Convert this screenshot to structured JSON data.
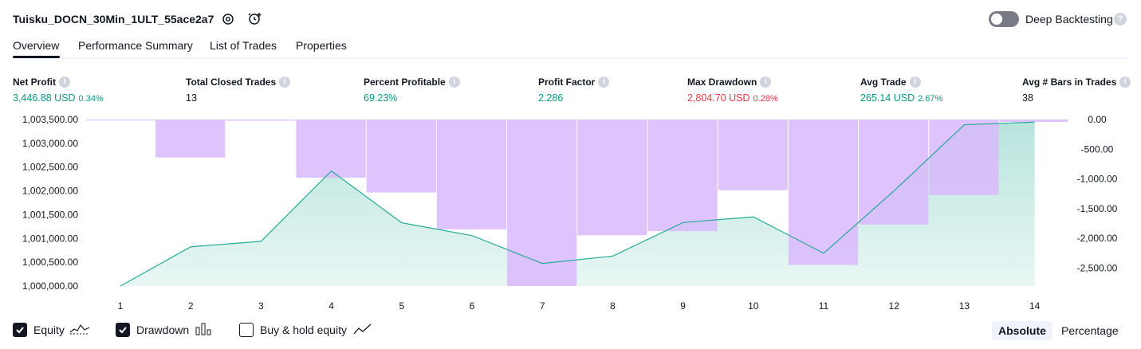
{
  "strategy_title": "Tuisku_DOCN_30Min_1ULT_55ace2a7",
  "deep_backtesting": {
    "label": "Deep Backtesting",
    "enabled": false,
    "help": "?"
  },
  "tabs": [
    {
      "label": "Overview",
      "active": true
    },
    {
      "label": "Performance Summary",
      "active": false
    },
    {
      "label": "List of Trades",
      "active": false
    },
    {
      "label": "Properties",
      "active": false
    }
  ],
  "metrics": [
    {
      "label": "Net Profit",
      "value": "3,446.88 USD",
      "pct": "0.34%",
      "color": "green"
    },
    {
      "label": "Total Closed Trades",
      "value": "13",
      "pct": "",
      "color": "black"
    },
    {
      "label": "Percent Profitable",
      "value": "69.23%",
      "pct": "",
      "color": "green"
    },
    {
      "label": "Profit Factor",
      "value": "2.286",
      "pct": "",
      "color": "green"
    },
    {
      "label": "Max Drawdown",
      "value": "2,804.70 USD",
      "pct": "0.28%",
      "color": "red"
    },
    {
      "label": "Avg Trade",
      "value": "265.14 USD",
      "pct": "2.67%",
      "color": "green"
    },
    {
      "label": "Avg # Bars in Trades",
      "value": "38",
      "pct": "",
      "color": "black"
    }
  ],
  "chart_data": {
    "type": "area",
    "x": [
      1,
      2,
      3,
      4,
      5,
      6,
      7,
      8,
      9,
      10,
      11,
      12,
      13,
      14
    ],
    "y_left_ticks": [
      "1,003,500.00",
      "1,003,000.00",
      "1,002,500.00",
      "1,002,000.00",
      "1,001,500.00",
      "1,001,000.00",
      "1,000,500.00",
      "1,000,000.00"
    ],
    "y_right_ticks": [
      "0.00",
      "-500.00",
      "-1,000.00",
      "-1,500.00",
      "-2,000.00",
      "-2,500.00"
    ],
    "y_left_range": [
      1000000,
      1003500
    ],
    "y_right_range": [
      -2804.7,
      0
    ],
    "series": [
      {
        "name": "Equity",
        "type": "line",
        "values": [
          1000000,
          1000825,
          1000940,
          1002420,
          1001330,
          1001060,
          1000475,
          1000630,
          1001335,
          1001455,
          1000690,
          1002000,
          1003390,
          1003446.88
        ]
      },
      {
        "name": "Drawdown",
        "type": "bar",
        "values": [
          0,
          -640,
          -20,
          -980,
          -1230,
          -1850,
          -2804.7,
          -1950,
          -1880,
          -1190,
          -2450,
          -1770,
          -1270,
          -40
        ]
      }
    ],
    "colors": {
      "equity_line": "#22ab94",
      "equity_fill": "#22ab94",
      "drawdown_bar": "#d9b8fb"
    },
    "grid": false
  },
  "legend": [
    {
      "label": "Equity",
      "checked": true,
      "icon": "equity-line-icon"
    },
    {
      "label": "Drawdown",
      "checked": true,
      "icon": "drawdown-bars-icon"
    },
    {
      "label": "Buy & hold equity",
      "checked": false,
      "icon": "buy-hold-line-icon"
    }
  ],
  "scale_buttons": {
    "absolute": "Absolute",
    "percentage": "Percentage",
    "active": "absolute"
  }
}
